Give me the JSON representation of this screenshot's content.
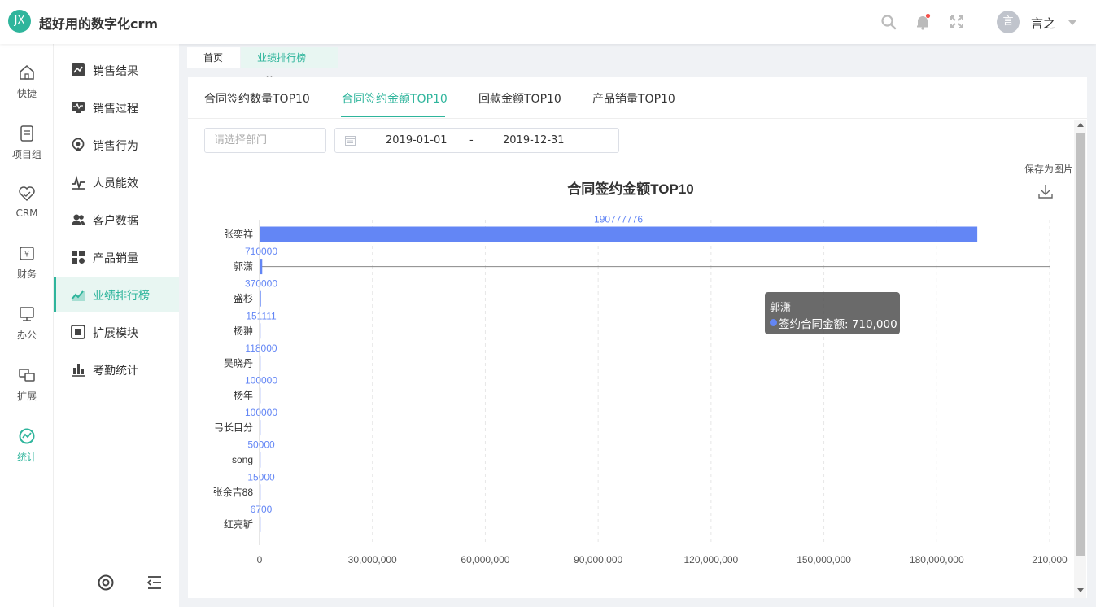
{
  "header": {
    "logo": "JX",
    "title": "超好用的数字化crm",
    "user_name": "言之",
    "avatar": "言"
  },
  "rail": [
    {
      "label": "快捷",
      "icon": "home-icon"
    },
    {
      "label": "项目组",
      "icon": "document-icon"
    },
    {
      "label": "CRM",
      "icon": "heart-icon"
    },
    {
      "label": "财务",
      "icon": "wallet-icon"
    },
    {
      "label": "办公",
      "icon": "monitor-icon"
    },
    {
      "label": "扩展",
      "icon": "extend-icon"
    },
    {
      "label": "统计",
      "icon": "stats-icon",
      "active": true
    }
  ],
  "subnav": [
    {
      "label": "销售结果",
      "icon": "sales-result-icon"
    },
    {
      "label": "销售过程",
      "icon": "sales-process-icon"
    },
    {
      "label": "销售行为",
      "icon": "sales-behavior-icon"
    },
    {
      "label": "人员能效",
      "icon": "staff-efficiency-icon"
    },
    {
      "label": "客户数据",
      "icon": "customer-data-icon"
    },
    {
      "label": "产品销量",
      "icon": "product-sales-icon"
    },
    {
      "label": "业绩排行榜",
      "icon": "ranking-icon",
      "active": true
    },
    {
      "label": "扩展模块",
      "icon": "extension-module-icon"
    },
    {
      "label": "考勤统计",
      "icon": "attendance-icon"
    }
  ],
  "tabs": [
    {
      "label": "首页"
    },
    {
      "label": "业绩排行榜",
      "active": true,
      "close": "×"
    }
  ],
  "content_tabs": [
    {
      "label": "合同签约数量TOP10"
    },
    {
      "label": "合同签约金额TOP10",
      "active": true
    },
    {
      "label": "回款金额TOP10"
    },
    {
      "label": "产品销量TOP10"
    }
  ],
  "filters": {
    "dept_placeholder": "请选择部门",
    "start_date": "2019-01-01",
    "separator": "-",
    "end_date": "2019-12-31"
  },
  "save_as_image": "保存为图片",
  "tooltip": {
    "title": "郭潇",
    "text": "签约合同金额: 710,000"
  },
  "colors": {
    "accent": "#2fb59c",
    "bar": "#6386f5"
  },
  "chart_data": {
    "type": "bar",
    "orientation": "horizontal",
    "title": "合同签约金额TOP10",
    "categories": [
      "张奕祥",
      "郭潇",
      "盛杉",
      "杨翀",
      "吴晓丹",
      "杨年",
      "弓长目分",
      "song",
      "张余吉88",
      "红亮靳"
    ],
    "series": [
      {
        "values": [
          190777776,
          710000,
          370000,
          151111,
          118000,
          100000,
          100000,
          50000,
          15000,
          6700
        ]
      }
    ],
    "xlim": [
      0,
      210000000
    ],
    "xticks": [
      "0",
      "30,000,000",
      "60,000,000",
      "90,000,000",
      "120,000,000",
      "150,000,000",
      "180,000,000",
      "210,000"
    ],
    "grid": true,
    "highlighted": "郭潇"
  }
}
